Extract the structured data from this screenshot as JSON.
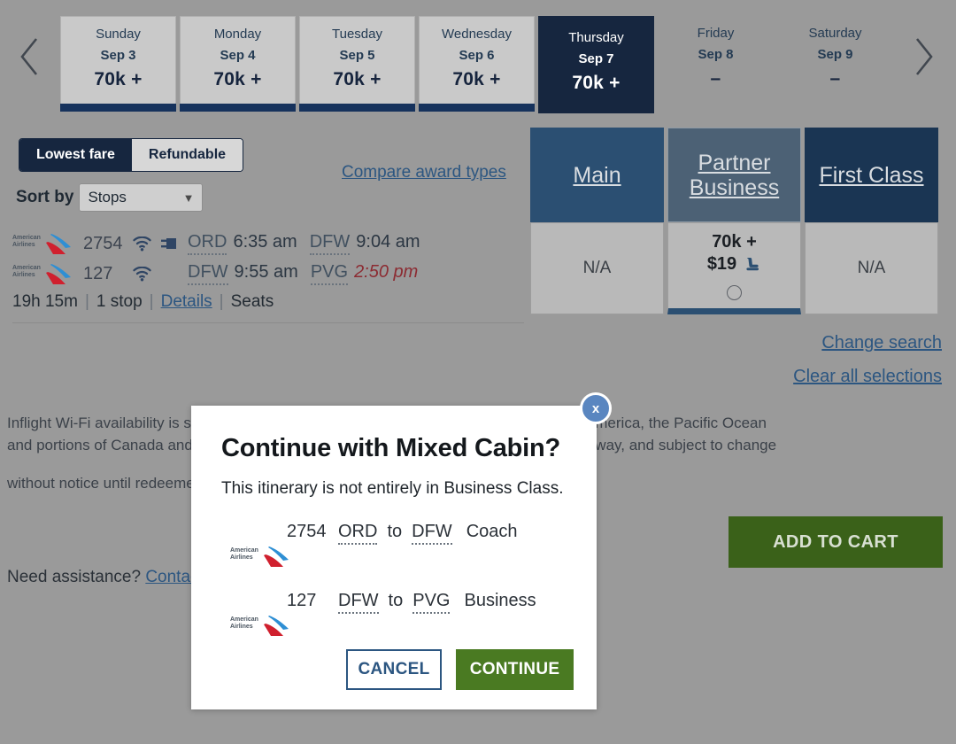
{
  "date_strip": {
    "prev_icon": "chevron-left-icon",
    "next_icon": "chevron-right-icon",
    "days": [
      {
        "dow": "Sunday",
        "date": "Sep 3",
        "price": "70k +",
        "selected": false,
        "available": true
      },
      {
        "dow": "Monday",
        "date": "Sep 4",
        "price": "70k +",
        "selected": false,
        "available": true
      },
      {
        "dow": "Tuesday",
        "date": "Sep 5",
        "price": "70k +",
        "selected": false,
        "available": true
      },
      {
        "dow": "Wednesday",
        "date": "Sep 6",
        "price": "70k +",
        "selected": false,
        "available": true
      },
      {
        "dow": "Thursday",
        "date": "Sep 7",
        "price": "70k +",
        "selected": true,
        "available": true
      },
      {
        "dow": "Friday",
        "date": "Sep 8",
        "price": "–",
        "selected": false,
        "available": false
      },
      {
        "dow": "Saturday",
        "date": "Sep 9",
        "price": "–",
        "selected": false,
        "available": false
      }
    ]
  },
  "filters": {
    "fare_toggle": {
      "options": [
        "Lowest fare",
        "Refundable"
      ],
      "selected": "Lowest fare"
    },
    "sort_by_label": "Sort by",
    "sort_select": {
      "value": "Stops",
      "chevron": "chevron-down-icon"
    },
    "compare_link": "Compare award types"
  },
  "cabins": {
    "columns": [
      {
        "label": "Main",
        "state": "available",
        "cell": {
          "type": "na",
          "na": "N/A"
        }
      },
      {
        "label": "Partner Business",
        "state": "selected",
        "cell": {
          "type": "price",
          "points": "70k +",
          "cash": "$19",
          "seat_icon": "seat-icon",
          "radio": "radio-button-unselected"
        }
      },
      {
        "label": "First Class",
        "state": "available",
        "cell": {
          "type": "na",
          "na": "N/A"
        }
      }
    ]
  },
  "itinerary": {
    "segments": [
      {
        "airline": "American Airlines",
        "flight_no": "2754",
        "amenities": [
          "wifi-icon",
          "power-outlet-icon"
        ],
        "origin": "ORD",
        "depart": "6:35 am",
        "destination": "DFW",
        "arrive": "9:04 am",
        "arrive_next_day": false
      },
      {
        "airline": "American Airlines",
        "flight_no": "127",
        "amenities": [
          "wifi-icon"
        ],
        "origin": "DFW",
        "depart": "9:55 am",
        "destination": "PVG",
        "arrive": "2:50 pm",
        "arrive_next_day": true
      }
    ],
    "duration": "19h 15m",
    "stops": "1 stop",
    "details_link": "Details",
    "seats_link": "Seats",
    "separator": "|"
  },
  "right_links": {
    "change_search": "Change search",
    "clear_all": "Clear all selections"
  },
  "disclaimer": {
    "line1": "Inflight Wi-Fi availability is subject to change and may be limited when flying over Latin America, the Pacific Ocean",
    "line2": "and portions of Canada and Mexico. Prices and award levels shown in U.S. dollars, one way, and subject to change",
    "line3": "without notice until redeemed."
  },
  "assistance": {
    "text": "Need assistance? ",
    "link": "Contact us"
  },
  "add_to_cart": "ADD TO CART",
  "modal": {
    "close_icon": "close-icon",
    "close_label": "x",
    "title": "Continue with Mixed Cabin?",
    "subtitle": "This itinerary is not entirely in Business Class.",
    "segments": [
      {
        "airline": "American Airlines",
        "flight_no": "2754",
        "origin": "ORD",
        "to": "to",
        "destination": "DFW",
        "cabin": "Coach"
      },
      {
        "airline": "American Airlines",
        "flight_no": "127",
        "origin": "DFW",
        "to": "to",
        "destination": "PVG",
        "cabin": "Business"
      }
    ],
    "cancel_label": "CANCEL",
    "continue_label": "CONTINUE"
  },
  "colors": {
    "page_background": "#9a9a9a",
    "navy_dark": "#16263f",
    "navy_first": "#1a3553",
    "blue_main": "#2b4f72",
    "slate_partner": "#4c6175",
    "link_blue": "#2c5681",
    "green_continue": "#4a7a22",
    "green_cart": "#3a6119",
    "arrive_red": "#8c2b32",
    "close_blue": "#5a86c0"
  },
  "airline_logo_text": {
    "line1": "American",
    "line2": "Airlines"
  }
}
